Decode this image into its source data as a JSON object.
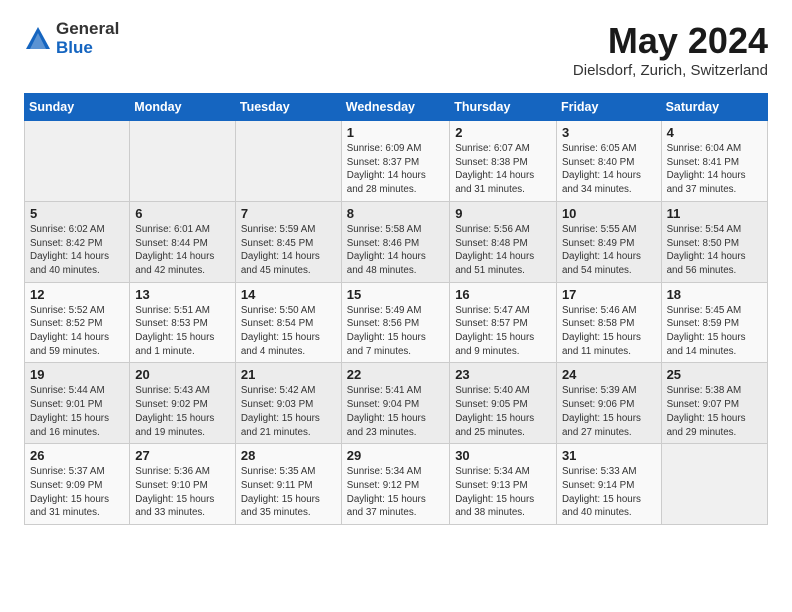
{
  "header": {
    "logo_general": "General",
    "logo_blue": "Blue",
    "title": "May 2024",
    "location": "Dielsdorf, Zurich, Switzerland"
  },
  "days_of_week": [
    "Sunday",
    "Monday",
    "Tuesday",
    "Wednesday",
    "Thursday",
    "Friday",
    "Saturday"
  ],
  "weeks": [
    [
      {
        "num": "",
        "info": ""
      },
      {
        "num": "",
        "info": ""
      },
      {
        "num": "",
        "info": ""
      },
      {
        "num": "1",
        "info": "Sunrise: 6:09 AM\nSunset: 8:37 PM\nDaylight: 14 hours\nand 28 minutes."
      },
      {
        "num": "2",
        "info": "Sunrise: 6:07 AM\nSunset: 8:38 PM\nDaylight: 14 hours\nand 31 minutes."
      },
      {
        "num": "3",
        "info": "Sunrise: 6:05 AM\nSunset: 8:40 PM\nDaylight: 14 hours\nand 34 minutes."
      },
      {
        "num": "4",
        "info": "Sunrise: 6:04 AM\nSunset: 8:41 PM\nDaylight: 14 hours\nand 37 minutes."
      }
    ],
    [
      {
        "num": "5",
        "info": "Sunrise: 6:02 AM\nSunset: 8:42 PM\nDaylight: 14 hours\nand 40 minutes."
      },
      {
        "num": "6",
        "info": "Sunrise: 6:01 AM\nSunset: 8:44 PM\nDaylight: 14 hours\nand 42 minutes."
      },
      {
        "num": "7",
        "info": "Sunrise: 5:59 AM\nSunset: 8:45 PM\nDaylight: 14 hours\nand 45 minutes."
      },
      {
        "num": "8",
        "info": "Sunrise: 5:58 AM\nSunset: 8:46 PM\nDaylight: 14 hours\nand 48 minutes."
      },
      {
        "num": "9",
        "info": "Sunrise: 5:56 AM\nSunset: 8:48 PM\nDaylight: 14 hours\nand 51 minutes."
      },
      {
        "num": "10",
        "info": "Sunrise: 5:55 AM\nSunset: 8:49 PM\nDaylight: 14 hours\nand 54 minutes."
      },
      {
        "num": "11",
        "info": "Sunrise: 5:54 AM\nSunset: 8:50 PM\nDaylight: 14 hours\nand 56 minutes."
      }
    ],
    [
      {
        "num": "12",
        "info": "Sunrise: 5:52 AM\nSunset: 8:52 PM\nDaylight: 14 hours\nand 59 minutes."
      },
      {
        "num": "13",
        "info": "Sunrise: 5:51 AM\nSunset: 8:53 PM\nDaylight: 15 hours\nand 1 minute."
      },
      {
        "num": "14",
        "info": "Sunrise: 5:50 AM\nSunset: 8:54 PM\nDaylight: 15 hours\nand 4 minutes."
      },
      {
        "num": "15",
        "info": "Sunrise: 5:49 AM\nSunset: 8:56 PM\nDaylight: 15 hours\nand 7 minutes."
      },
      {
        "num": "16",
        "info": "Sunrise: 5:47 AM\nSunset: 8:57 PM\nDaylight: 15 hours\nand 9 minutes."
      },
      {
        "num": "17",
        "info": "Sunrise: 5:46 AM\nSunset: 8:58 PM\nDaylight: 15 hours\nand 11 minutes."
      },
      {
        "num": "18",
        "info": "Sunrise: 5:45 AM\nSunset: 8:59 PM\nDaylight: 15 hours\nand 14 minutes."
      }
    ],
    [
      {
        "num": "19",
        "info": "Sunrise: 5:44 AM\nSunset: 9:01 PM\nDaylight: 15 hours\nand 16 minutes."
      },
      {
        "num": "20",
        "info": "Sunrise: 5:43 AM\nSunset: 9:02 PM\nDaylight: 15 hours\nand 19 minutes."
      },
      {
        "num": "21",
        "info": "Sunrise: 5:42 AM\nSunset: 9:03 PM\nDaylight: 15 hours\nand 21 minutes."
      },
      {
        "num": "22",
        "info": "Sunrise: 5:41 AM\nSunset: 9:04 PM\nDaylight: 15 hours\nand 23 minutes."
      },
      {
        "num": "23",
        "info": "Sunrise: 5:40 AM\nSunset: 9:05 PM\nDaylight: 15 hours\nand 25 minutes."
      },
      {
        "num": "24",
        "info": "Sunrise: 5:39 AM\nSunset: 9:06 PM\nDaylight: 15 hours\nand 27 minutes."
      },
      {
        "num": "25",
        "info": "Sunrise: 5:38 AM\nSunset: 9:07 PM\nDaylight: 15 hours\nand 29 minutes."
      }
    ],
    [
      {
        "num": "26",
        "info": "Sunrise: 5:37 AM\nSunset: 9:09 PM\nDaylight: 15 hours\nand 31 minutes."
      },
      {
        "num": "27",
        "info": "Sunrise: 5:36 AM\nSunset: 9:10 PM\nDaylight: 15 hours\nand 33 minutes."
      },
      {
        "num": "28",
        "info": "Sunrise: 5:35 AM\nSunset: 9:11 PM\nDaylight: 15 hours\nand 35 minutes."
      },
      {
        "num": "29",
        "info": "Sunrise: 5:34 AM\nSunset: 9:12 PM\nDaylight: 15 hours\nand 37 minutes."
      },
      {
        "num": "30",
        "info": "Sunrise: 5:34 AM\nSunset: 9:13 PM\nDaylight: 15 hours\nand 38 minutes."
      },
      {
        "num": "31",
        "info": "Sunrise: 5:33 AM\nSunset: 9:14 PM\nDaylight: 15 hours\nand 40 minutes."
      },
      {
        "num": "",
        "info": ""
      }
    ]
  ]
}
